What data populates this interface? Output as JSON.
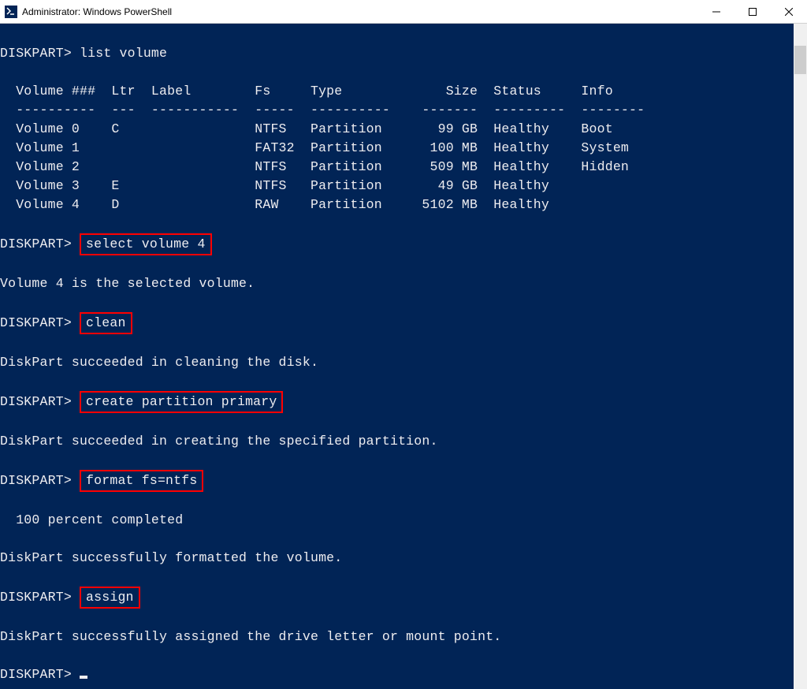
{
  "window": {
    "title": "Administrator: Windows PowerShell",
    "icon_label": "powershell-icon"
  },
  "prompt": "DISKPART>",
  "commands": {
    "list_volume": "list volume",
    "select_volume": "select volume 4",
    "clean": "clean",
    "create_partition": "create partition primary",
    "format": "format fs=ntfs",
    "assign": "assign"
  },
  "table": {
    "headers": [
      "Volume ###",
      "Ltr",
      "Label",
      "Fs",
      "Type",
      "Size",
      "Status",
      "Info"
    ],
    "sep": [
      "----------",
      "---",
      "-----------",
      "-----",
      "----------",
      "-------",
      "---------",
      "--------"
    ],
    "rows": [
      {
        "vol": "Volume 0",
        "ltr": "C",
        "label": "",
        "fs": "NTFS",
        "type": "Partition",
        "size": "99 GB",
        "status": "Healthy",
        "info": "Boot"
      },
      {
        "vol": "Volume 1",
        "ltr": "",
        "label": "",
        "fs": "FAT32",
        "type": "Partition",
        "size": "100 MB",
        "status": "Healthy",
        "info": "System"
      },
      {
        "vol": "Volume 2",
        "ltr": "",
        "label": "",
        "fs": "NTFS",
        "type": "Partition",
        "size": "509 MB",
        "status": "Healthy",
        "info": "Hidden"
      },
      {
        "vol": "Volume 3",
        "ltr": "E",
        "label": "",
        "fs": "NTFS",
        "type": "Partition",
        "size": "49 GB",
        "status": "Healthy",
        "info": ""
      },
      {
        "vol": "Volume 4",
        "ltr": "D",
        "label": "",
        "fs": "RAW",
        "type": "Partition",
        "size": "5102 MB",
        "status": "Healthy",
        "info": ""
      }
    ]
  },
  "messages": {
    "selected": "Volume 4 is the selected volume.",
    "clean_ok": "DiskPart succeeded in cleaning the disk.",
    "create_ok": "DiskPart succeeded in creating the specified partition.",
    "format_progress": "  100 percent completed",
    "format_ok": "DiskPart successfully formatted the volume.",
    "assign_ok": "DiskPart successfully assigned the drive letter or mount point."
  }
}
